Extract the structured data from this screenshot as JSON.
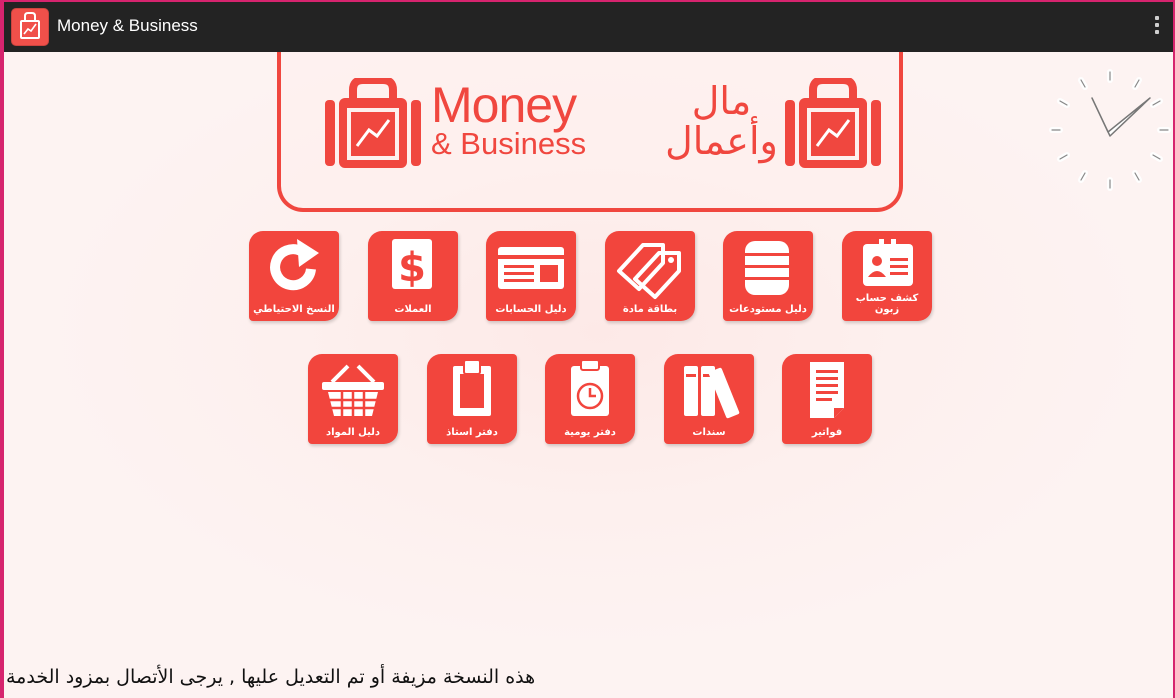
{
  "window": {
    "title": "Money & Business",
    "app_icon": "shopping-bag-chart-icon",
    "menu_icon": "overflow-menu-icon",
    "frame_color": "#d6246e",
    "titlebar_color": "#232323"
  },
  "logo": {
    "english_line1": "Money",
    "english_line2": "& Business",
    "arabic_line1": "مال",
    "arabic_line2": "وأعمال",
    "accent": "#f0473f"
  },
  "clock": {
    "icon": "analog-clock-icon"
  },
  "tiles_row1": [
    {
      "label": "كشف حساب زبون",
      "icon": "customer-card-icon"
    },
    {
      "label": "دليل مستودعات",
      "icon": "warehouse-stack-icon"
    },
    {
      "label": "بطاقة مادة",
      "icon": "price-tag-icon"
    },
    {
      "label": "دليل الحسابات",
      "icon": "accounts-card-icon"
    },
    {
      "label": "العملات",
      "icon": "dollar-icon"
    },
    {
      "label": "النسخ الاحتياطي",
      "icon": "backup-refresh-icon"
    }
  ],
  "tiles_row2": [
    {
      "label": "فواتير",
      "icon": "invoice-icon"
    },
    {
      "label": "سندات",
      "icon": "binders-icon"
    },
    {
      "label": "دفتر يومية",
      "icon": "journal-clock-icon"
    },
    {
      "label": "دفتر استاذ",
      "icon": "ledger-clipboard-icon"
    },
    {
      "label": "دليل المواد",
      "icon": "basket-icon"
    }
  ],
  "footer": {
    "warning": "هذه النسخة مزيفة أو تم التعديل عليها , يرجى الأتصال بمزود الخدمة"
  }
}
